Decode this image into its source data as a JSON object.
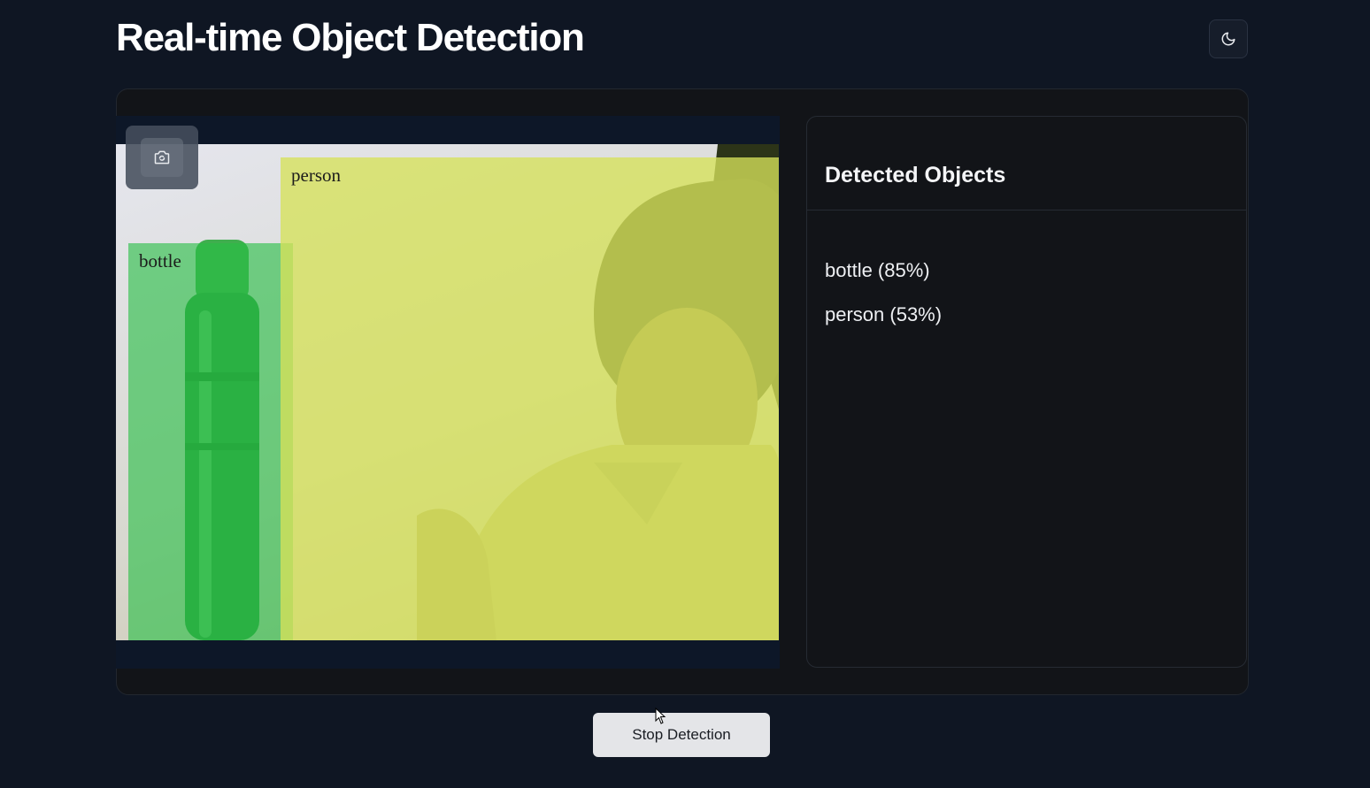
{
  "header": {
    "title": "Real-time Object Detection",
    "theme_toggle_icon": "moon-icon"
  },
  "video": {
    "switch_camera_icon": "camera-switch-icon",
    "detections": [
      {
        "label": "bottle",
        "color": "#28be46"
      },
      {
        "label": "person",
        "color": "#d6e25a"
      }
    ]
  },
  "panel": {
    "title": "Detected Objects",
    "items": [
      {
        "text": "bottle (85%)"
      },
      {
        "text": "person (53%)"
      }
    ]
  },
  "controls": {
    "stop_label": "Stop Detection"
  },
  "colors": {
    "background": "#0f1623",
    "card": "#121418",
    "button": "#e4e5e8"
  }
}
